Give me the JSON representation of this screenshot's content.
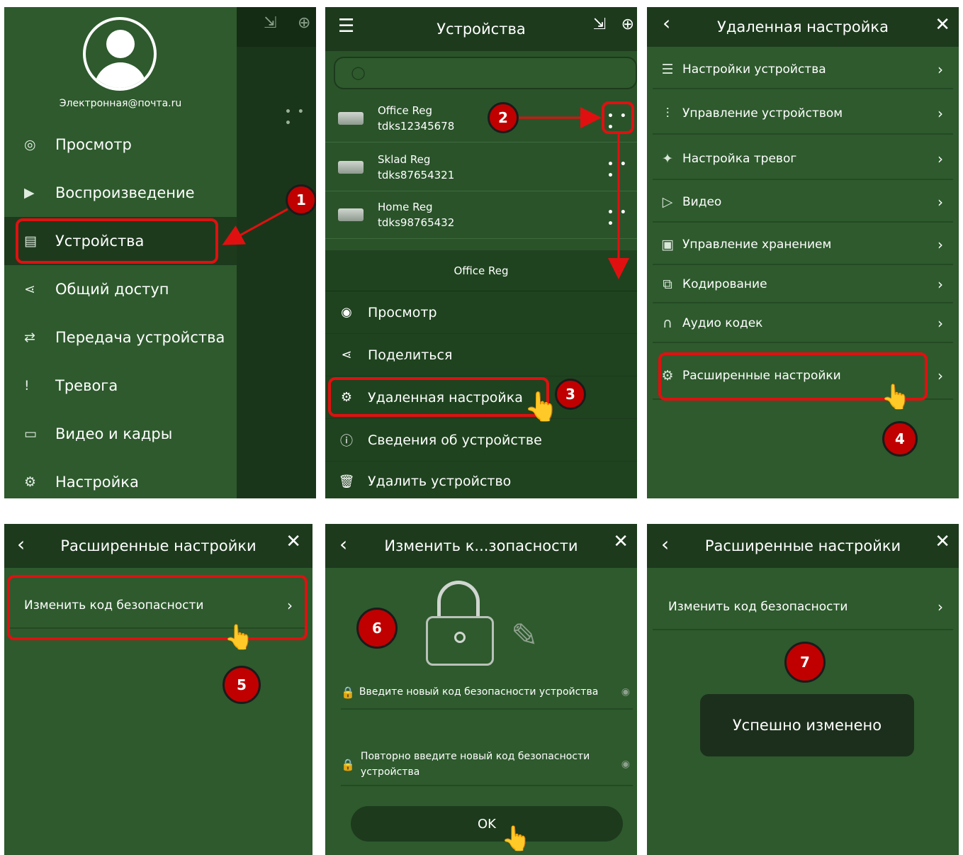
{
  "p1": {
    "email": "Электронная@почта.ru",
    "items": [
      {
        "icon": "eye-circle-icon",
        "glyph": "◎",
        "label": "Просмотр"
      },
      {
        "icon": "play-circle-icon",
        "glyph": "▶",
        "label": "Воспроизведение"
      },
      {
        "icon": "device-icon",
        "glyph": "▤",
        "label": "Устройства"
      },
      {
        "icon": "share-icon",
        "glyph": "⋖",
        "label": "Общий доступ"
      },
      {
        "icon": "transfer-icon",
        "glyph": "⇄",
        "label": "Передача устройства"
      },
      {
        "icon": "alarm-icon",
        "glyph": "!",
        "label": "Тревога"
      },
      {
        "icon": "folder-icon",
        "glyph": "▭",
        "label": "Видео и кадры"
      },
      {
        "icon": "settings-icon",
        "glyph": "⚙",
        "label": "Настройка"
      }
    ],
    "bg_dots": "• • •",
    "badge": "1"
  },
  "p2": {
    "title": "Устройства",
    "devices": [
      {
        "name": "Office Reg",
        "id": "tdks12345678",
        "more": "• • •"
      },
      {
        "name": "Sklad Reg",
        "id": "tdks87654321",
        "more": "• • •"
      },
      {
        "name": "Home Reg",
        "id": "tdks98765432",
        "more": "• • •"
      }
    ],
    "menu_title": "Office Reg",
    "menu": [
      {
        "icon": "eye-icon",
        "glyph": "◉",
        "label": "Просмотр"
      },
      {
        "icon": "share-icon",
        "glyph": "⋖",
        "label": "Поделиться"
      },
      {
        "icon": "gear-icon",
        "glyph": "⚙",
        "label": "Удаленная настройка"
      },
      {
        "icon": "info-icon",
        "glyph": "ⓘ",
        "label": "Сведения об устройстве"
      },
      {
        "icon": "trash-icon",
        "glyph": "🗑",
        "label": "Удалить устройство"
      }
    ],
    "badge2": "2",
    "badge3": "3"
  },
  "p3": {
    "title": "Удаленная настройка",
    "items": [
      {
        "icon": "list-icon",
        "glyph": "☰",
        "label": "Настройки устройства"
      },
      {
        "icon": "sliders-icon",
        "glyph": "⫶",
        "label": "Управление устройством"
      },
      {
        "icon": "running-man-icon",
        "glyph": "✦",
        "label": "Настройка тревог"
      },
      {
        "icon": "video-icon",
        "glyph": "▷",
        "label": "Видео"
      },
      {
        "icon": "hdd-icon",
        "glyph": "▣",
        "label": "Управление хранением"
      },
      {
        "icon": "code-icon",
        "glyph": "⧉",
        "label": "Кодирование"
      },
      {
        "icon": "headphones-icon",
        "glyph": "∩",
        "label": "Аудио кодек"
      },
      {
        "icon": "gear-icon",
        "glyph": "⚙",
        "label": "Расширенные настройки"
      }
    ],
    "badge": "4"
  },
  "p4": {
    "title": "Расширенные настройки",
    "item": "Изменить код безопасности",
    "badge": "5"
  },
  "p5": {
    "title": "Изменить к...зопасности",
    "field1": "Введите новый код безопасности устройства",
    "field2": "Повторно введите новый код безопасности устройства",
    "ok": "OK",
    "badge": "6"
  },
  "p6": {
    "title": "Расширенные настройки",
    "item": "Изменить код безопасности",
    "toast": "Успешно изменено",
    "badge": "7"
  },
  "common": {
    "chevron": "›",
    "back": "‹",
    "close": "✕"
  }
}
